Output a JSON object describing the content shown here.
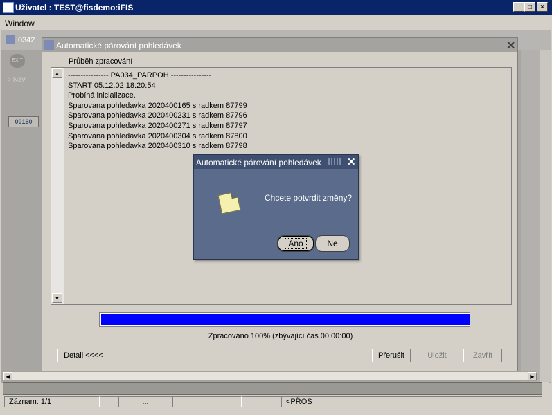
{
  "window": {
    "title": "Uživatel : TEST@fisdemo:iFIS",
    "menu": "Window"
  },
  "background_child": {
    "title_fragment": "0342",
    "exit_label": "EXIT",
    "nav_label": "Nav",
    "record_code": "00160"
  },
  "child": {
    "title": "Automatické párování pohledávek",
    "section_label": "Průběh zpracování",
    "log_lines": [
      "---------------- PA034_PARPOH ----------------",
      "START 05.12.02 18:20:54",
      "Probíhá inicializace.",
      "Sparovana pohledavka 2020400165 s radkem 87799",
      "Sparovana pohledavka 2020400231 s radkem 87796",
      "Sparovana pohledavka 2020400271 s radkem 87797",
      "Sparovana pohledavka 2020400304 s radkem 87800",
      "Sparovana pohledavka 2020400310 s radkem 87798"
    ],
    "progress_fraction": 1.0,
    "progress_color": "#0000ff",
    "progress_text": "Zpracováno 100% (zbývající čas 00:00:00)",
    "buttons": {
      "detail": "Detail <<<<",
      "interrupt": "Přerušit",
      "save": "Uložit",
      "close": "Zavřít"
    }
  },
  "dialog": {
    "title": "Automatické párování pohledávek",
    "message": "Chcete potvrdit změny?",
    "yes_label": "Ano",
    "no_label": "Ne",
    "icon": "note-icon"
  },
  "status_bar": {
    "record": "Záznam: 1/1",
    "cell3": "...",
    "cell6": "<PŘOS"
  },
  "colors": {
    "title_active": "#0a246a",
    "dialog_bg": "#5b6b8c"
  }
}
